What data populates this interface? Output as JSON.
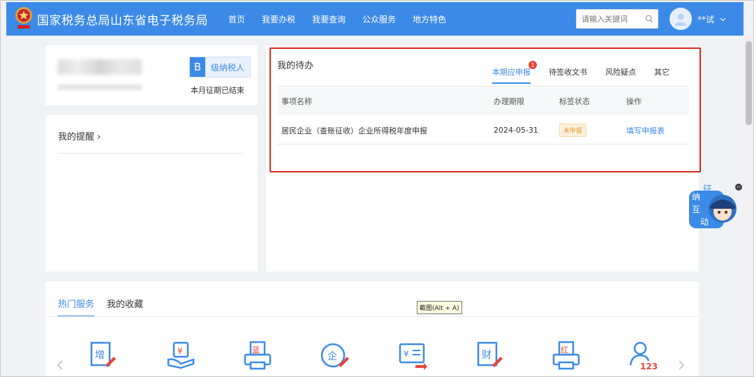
{
  "header": {
    "site_title": "国家税务总局山东省电子税务局",
    "nav": [
      "首页",
      "我要办税",
      "我要查询",
      "公众服务",
      "地方特色"
    ],
    "search_placeholder": "请输入关键词",
    "user_name": "**试",
    "brand_color": "#3c8ae7"
  },
  "profile": {
    "grade_letter": "B",
    "grade_label": "级纳税人",
    "period_status": "本月征期已结束"
  },
  "reminder": {
    "title": "我的提醒 ›"
  },
  "todo": {
    "title": "我的待办",
    "tabs": [
      {
        "label": "本期应申报",
        "badge": "1",
        "active": true
      },
      {
        "label": "待签收文书"
      },
      {
        "label": "风险疑点"
      },
      {
        "label": "其它"
      }
    ],
    "columns": [
      "事项名称",
      "办理期限",
      "标签状态",
      "操作"
    ],
    "rows": [
      {
        "name": "居民企业（查账征收）企业所得税年度申报",
        "deadline": "2024-05-31",
        "status": "未申报",
        "action": "填写申报表"
      }
    ],
    "highlight_color": "#d9291c"
  },
  "mascot": {
    "chars": [
      "征",
      "纳",
      "互",
      "动"
    ],
    "close": "−"
  },
  "services": {
    "tabs": [
      "热门服务",
      "我的收藏"
    ],
    "icons": [
      {
        "name": "invoice-increase-icon",
        "glyph": "增"
      },
      {
        "name": "payment-hand-icon",
        "glyph": "¥"
      },
      {
        "name": "printer-blue-icon",
        "glyph": "蓝"
      },
      {
        "name": "enterprise-edit-icon",
        "glyph": "企"
      },
      {
        "name": "transfer-yen-icon",
        "glyph": "¥"
      },
      {
        "name": "finance-edit-icon",
        "glyph": "财"
      },
      {
        "name": "printer-red-icon",
        "glyph": "红"
      },
      {
        "name": "user-123-icon",
        "glyph": "123"
      }
    ]
  },
  "tooltip": "截图(Alt + A)"
}
